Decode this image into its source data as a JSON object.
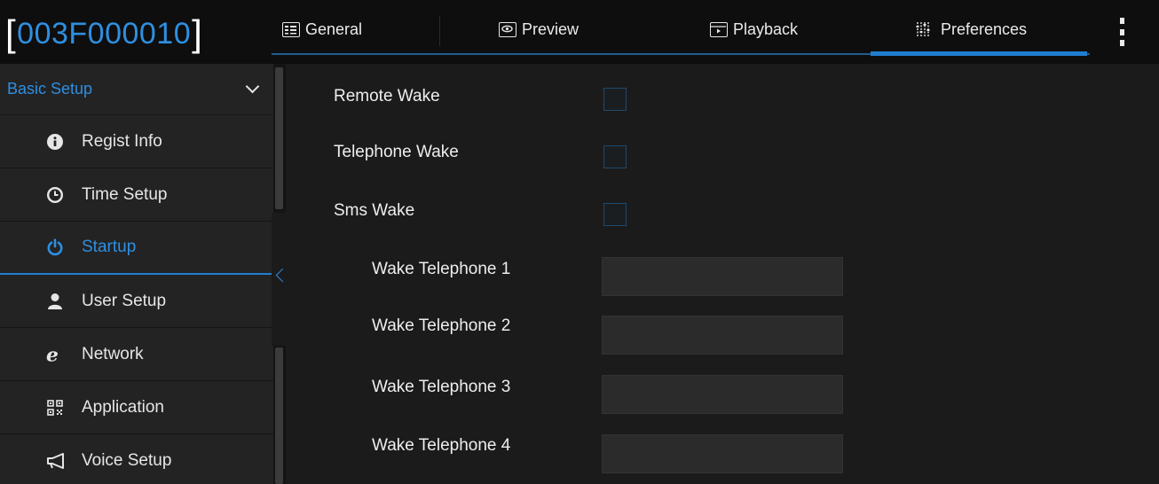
{
  "header": {
    "device_id": "003F000010",
    "tabs": [
      {
        "label": "General",
        "icon": "general-icon",
        "active": false
      },
      {
        "label": "Preview",
        "icon": "preview-icon",
        "active": false
      },
      {
        "label": "Playback",
        "icon": "playback-icon",
        "active": false
      },
      {
        "label": "Preferences",
        "icon": "preferences-icon",
        "active": true
      }
    ]
  },
  "sidebar": {
    "group_label": "Basic Setup",
    "items": [
      {
        "label": "Regist Info",
        "icon": "info-icon"
      },
      {
        "label": "Time Setup",
        "icon": "clock-icon"
      },
      {
        "label": "Startup",
        "icon": "power-icon",
        "active": true
      },
      {
        "label": "User Setup",
        "icon": "user-icon"
      },
      {
        "label": "Network",
        "icon": "ie-browser-icon"
      },
      {
        "label": "Application",
        "icon": "qr-code-icon"
      },
      {
        "label": "Voice Setup",
        "icon": "megaphone-icon"
      }
    ]
  },
  "main": {
    "remote_wake": {
      "label": "Remote Wake",
      "checked": false
    },
    "telephone_wake": {
      "label": "Telephone Wake",
      "checked": false
    },
    "sms_wake": {
      "label": "Sms Wake",
      "checked": false
    },
    "wake_telephones": [
      {
        "label": "Wake Telephone 1",
        "value": ""
      },
      {
        "label": "Wake Telephone 2",
        "value": ""
      },
      {
        "label": "Wake Telephone 3",
        "value": ""
      },
      {
        "label": "Wake Telephone 4",
        "value": ""
      }
    ]
  },
  "colors": {
    "accent": "#2d8fe3",
    "background": "#1b1b1b",
    "sidebar": "#232323",
    "header": "#0e0e0e"
  }
}
